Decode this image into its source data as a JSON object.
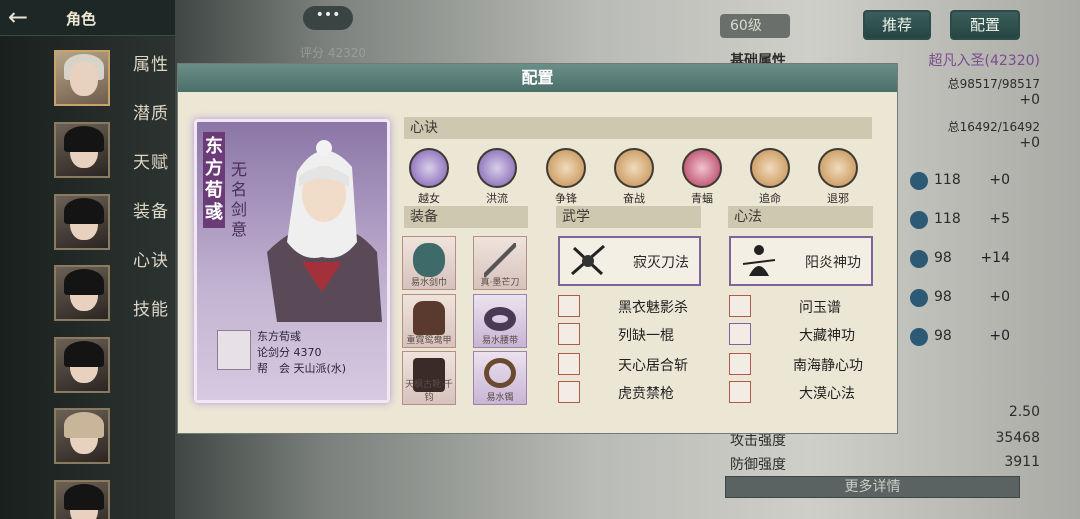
{
  "nav": {
    "back_icon": "arrow-left-icon",
    "title": "角色",
    "categories": [
      "属性",
      "潜质",
      "天赋",
      "装备",
      "心诀",
      "技能"
    ]
  },
  "top": {
    "score_label": "评分 42320",
    "chat_icon": "ellipsis-icon",
    "level": "60级",
    "btn_recommend": "推荐",
    "btn_config": "配置"
  },
  "stats": {
    "base_label": "基础属性",
    "rank": "超凡入圣(42320)",
    "hp_prefix": "总",
    "hp": "98517/98517",
    "hp_delta": "+0",
    "mp_prefix": "总",
    "mp": "16492/16492",
    "mp_delta": "+0",
    "attrs": [
      {
        "n": "118",
        "d": "+0"
      },
      {
        "n": "118",
        "d": "+5"
      },
      {
        "n": "98",
        "d": "+14"
      },
      {
        "n": "98",
        "d": "+0"
      },
      {
        "n": "98",
        "d": "+0"
      }
    ],
    "crit": "2.50",
    "attack_label": "攻击强度",
    "attack": "35468",
    "defense_label": "防御强度",
    "defense": "3911",
    "more": "更多详情"
  },
  "modal": {
    "title": "配置",
    "card": {
      "name": "东方荀彧",
      "title": "无名剑意",
      "info_name": "东方荀彧",
      "info_score": "论剑分 4370",
      "info_guild": "帮　会 天山派(水)"
    },
    "xinjue_label": "心诀",
    "xinjue": [
      {
        "name": "越女",
        "color": "#7a5ab0"
      },
      {
        "name": "洪流",
        "color": "#7a5ab0"
      },
      {
        "name": "争锋",
        "color": "#c08a4a"
      },
      {
        "name": "奋战",
        "color": "#c08a4a"
      },
      {
        "name": "青蝠",
        "color": "#b0365a"
      },
      {
        "name": "追命",
        "color": "#c08a4a"
      },
      {
        "name": "退邪",
        "color": "#c08a4a"
      }
    ],
    "equip_label": "装备",
    "equips": [
      {
        "label": "易水剑巾",
        "style": "red"
      },
      {
        "label": "真·墨芒刀",
        "style": "red"
      },
      {
        "label": "重霓鸳鸯甲",
        "style": "red"
      },
      {
        "label": "易水腰带",
        "style": "purple"
      },
      {
        "label": "天枫古靴·千钧",
        "style": "red"
      },
      {
        "label": "易水镯",
        "style": "purple"
      }
    ],
    "wuxue_label": "武学",
    "wuxue_main": "寂灭刀法",
    "wuxue_list": [
      "黑衣魅影杀",
      "列缺一棍",
      "天心居合斩",
      "虎贲禁枪"
    ],
    "xinfa_label": "心法",
    "xinfa_main": "阳炎神功",
    "xinfa_list": [
      "问玉谱",
      "大藏神功",
      "南海静心功",
      "大漠心法"
    ]
  }
}
